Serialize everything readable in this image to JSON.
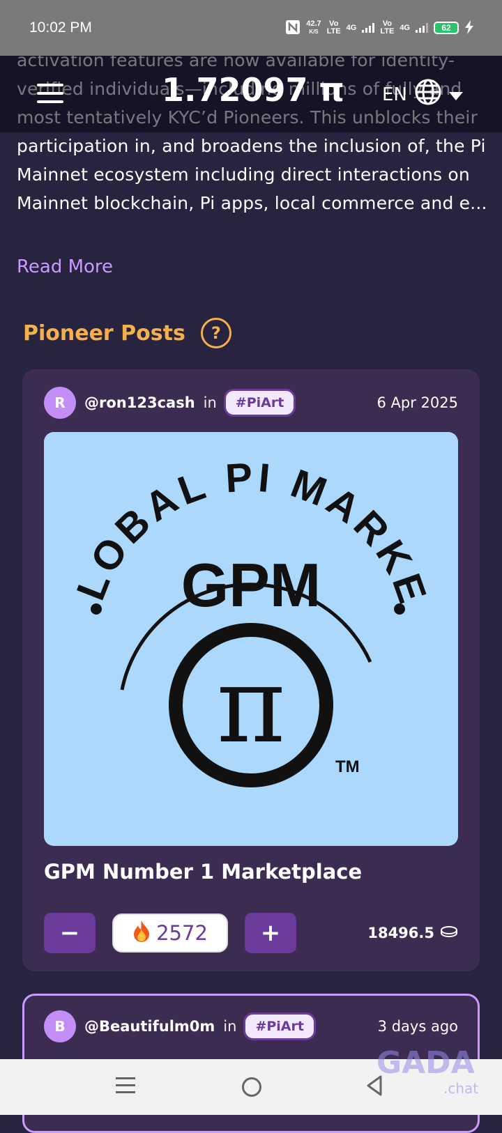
{
  "status_bar": {
    "time": "10:02 PM",
    "speed": "42.7",
    "speed_unit": "K/S",
    "sim1_top": "Vo",
    "sim1_bottom": "LTE",
    "net1": "4G",
    "sim2_top": "Vo",
    "sim2_bottom": "LTE",
    "net2": "4G",
    "battery": "62",
    "icons": [
      "nfc-icon",
      "signal-icon",
      "battery-icon",
      "charging-icon"
    ]
  },
  "header": {
    "balance": "1.72097 π",
    "language": "EN",
    "icons": [
      "menu-icon",
      "globe-icon",
      "chevron-down-icon"
    ]
  },
  "article": {
    "text": "activation features are now available for identity-verified individuals—including millions of fully and most tentatively KYC’d Pioneers. This unblocks their participation in, and broadens the inclusion of, the Pi Mainnet ecosystem including direct interactions on Mainnet blockchain, Pi apps, local commerce and e...",
    "read_more": "Read More"
  },
  "section": {
    "title": "Pioneer Posts",
    "help": "?"
  },
  "posts": [
    {
      "avatar_letter": "R",
      "author": "@ron123cash",
      "in_label": "in",
      "tag": "#PiArt",
      "date": "6 Apr 2025",
      "image": {
        "arc_text": "GLOBAL PI MARKET",
        "logo_text": "GPM",
        "symbol": "π",
        "tm": "TM",
        "background": "#acd8fc"
      },
      "title": "GPM Number 1 Marketplace",
      "minus": "−",
      "plus": "+",
      "score": "2572",
      "amount": "18496.5"
    },
    {
      "avatar_letter": "B",
      "author": "@Beautifulm0m",
      "in_label": "in",
      "tag": "#PiArt",
      "date": "3 days ago"
    }
  ],
  "watermark": {
    "brand": "GADA",
    "sub": ".chat"
  },
  "colors": {
    "background": "#28233f",
    "card": "#3c2c52",
    "accent_purple": "#6a3b9b",
    "link": "#c99bff",
    "section_title": "#f5b04e"
  }
}
